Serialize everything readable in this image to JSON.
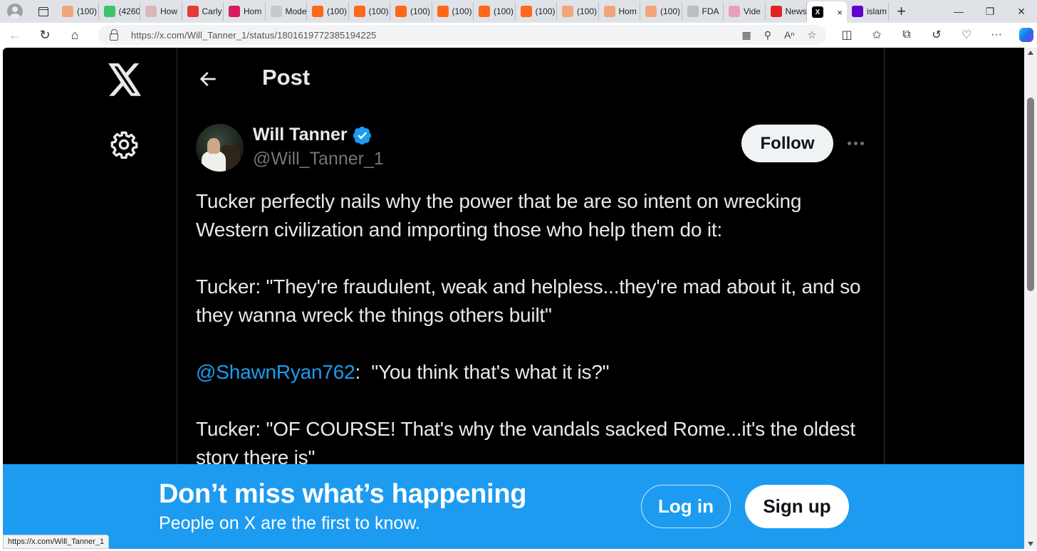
{
  "browser": {
    "tabs": [
      {
        "label": "(100)",
        "favicon_color": "#f0a67a"
      },
      {
        "label": "(4260",
        "favicon_color": "#3cc46a"
      },
      {
        "label": "How",
        "favicon_color": "#d9b8b8"
      },
      {
        "label": "Carly",
        "favicon_color": "#e53935"
      },
      {
        "label": "Hom",
        "favicon_color": "#d81b60"
      },
      {
        "label": "Mode",
        "favicon_color": "#c8c8c8"
      },
      {
        "label": "(100)",
        "favicon_color": "#ff6719"
      },
      {
        "label": "(100)",
        "favicon_color": "#ff6719"
      },
      {
        "label": "(100)",
        "favicon_color": "#ff6719"
      },
      {
        "label": "(100)",
        "favicon_color": "#ff6719"
      },
      {
        "label": "(100)",
        "favicon_color": "#ff6719"
      },
      {
        "label": "(100)",
        "favicon_color": "#ff6719"
      },
      {
        "label": "(100)",
        "favicon_color": "#f0a67a"
      },
      {
        "label": "Hom",
        "favicon_color": "#f0a67a"
      },
      {
        "label": "(100)",
        "favicon_color": "#f0a67a"
      },
      {
        "label": "FDA",
        "favicon_color": "#bdbdbd"
      },
      {
        "label": "Vide",
        "favicon_color": "#e8a0c0"
      },
      {
        "label": "News",
        "favicon_color": "#e02424"
      }
    ],
    "active_tab": {
      "label": "X",
      "close": "×"
    },
    "last_tab": {
      "label": "islam",
      "favicon_color": "#6001d2"
    },
    "new_tab": "+",
    "url": "https://x.com/Will_Tanner_1/status/1801619772385194225",
    "status_url": "https://x.com/Will_Tanner_1"
  },
  "page": {
    "header_title": "Post",
    "author": {
      "name": "Will Tanner",
      "handle": "@Will_Tanner_1",
      "verified": true
    },
    "follow_label": "Follow",
    "tweet": {
      "line1": "Tucker perfectly nails why the power that be are so intent on wrecking Western civilization and importing those who help them do it:",
      "line2": "Tucker: \"They're fraudulent, weak and helpless...they're mad about it, and so they wanna wreck the things others built\"",
      "mention": "@ShawnRyan762",
      "line3_rest": ":  \"You think that's what it is?\"",
      "line4": "Tucker: \"OF COURSE! That's why the vandals sacked Rome...it's the oldest story there is\""
    }
  },
  "banner": {
    "title": "Don’t miss what’s happening",
    "subtitle": "People on X are the first to know.",
    "login_label": "Log in",
    "signup_label": "Sign up"
  },
  "colors": {
    "accent": "#1d9bf0",
    "background": "#000000",
    "text": "#e7e9ea",
    "muted": "#71767b"
  }
}
